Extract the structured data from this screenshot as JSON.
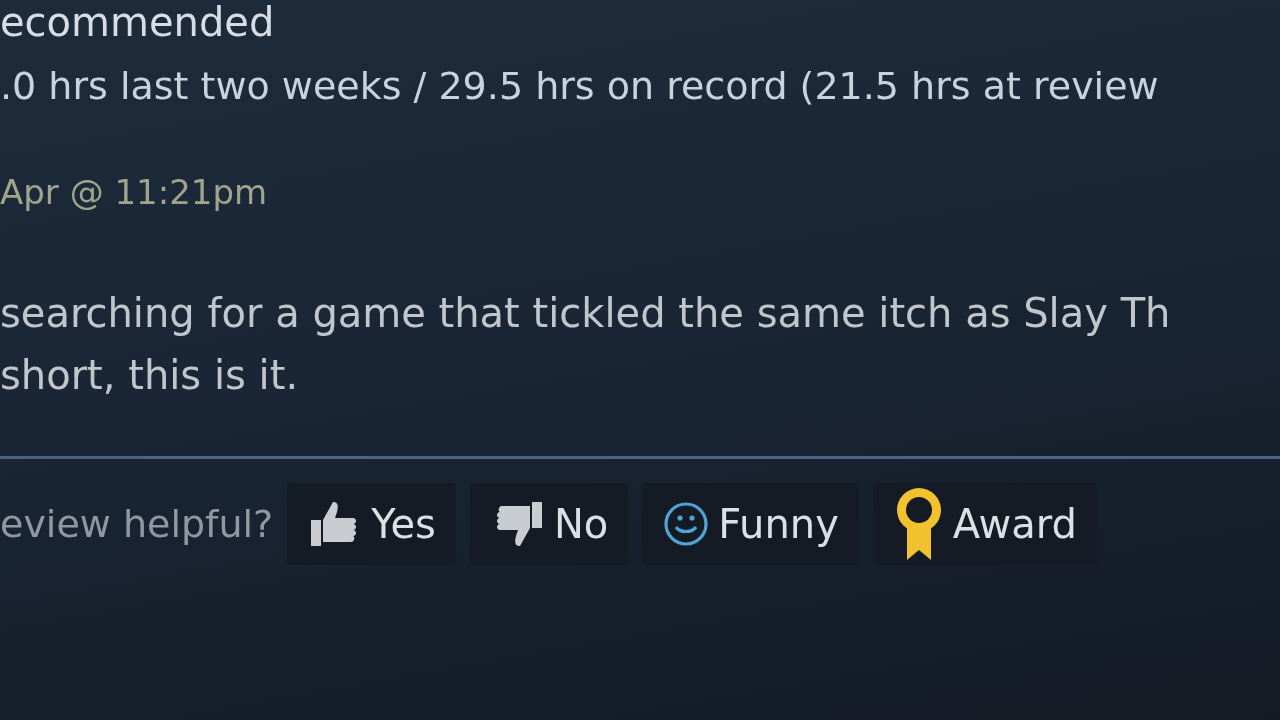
{
  "review": {
    "verdict": "ecommended",
    "hours": ".0 hrs last two weeks / 29.5 hrs on record (21.5 hrs at review",
    "posted": "Apr @ 11:21pm",
    "body": [
      "searching for a game that tickled the same itch as Slay Th",
      "short, this is it."
    ]
  },
  "helpful": {
    "prompt": "eview helpful?",
    "buttons": [
      {
        "kind": "yes",
        "label": "Yes"
      },
      {
        "kind": "no",
        "label": "No"
      },
      {
        "kind": "funny",
        "label": "Funny"
      },
      {
        "kind": "award",
        "label": "Award"
      }
    ]
  }
}
